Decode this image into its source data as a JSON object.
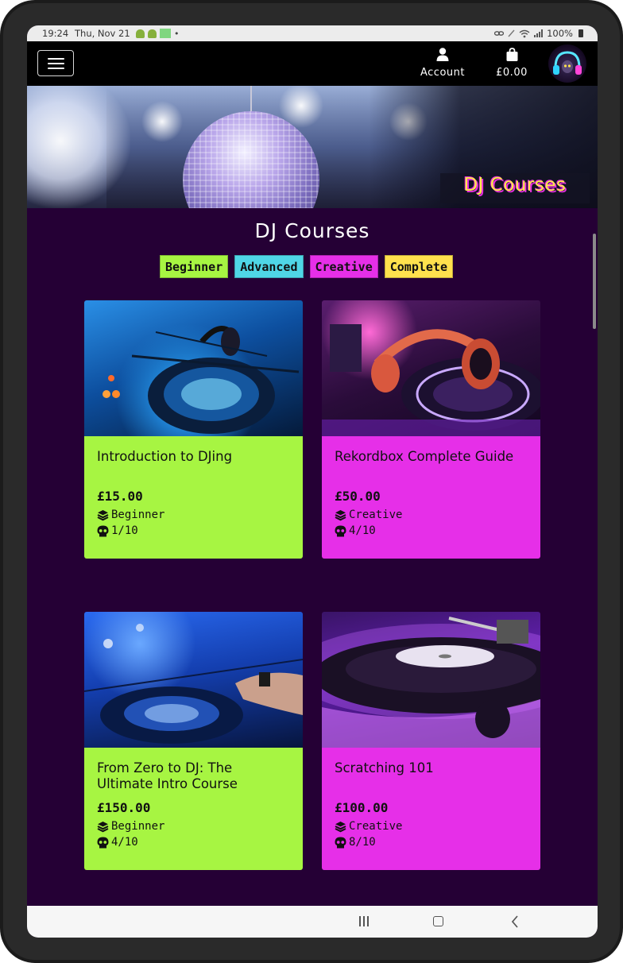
{
  "status_bar": {
    "time": "19:24",
    "date": "Thu, Nov 21",
    "dot": "•",
    "battery": "100%"
  },
  "navbar": {
    "account_label": "Account",
    "cart_total": "£0.00"
  },
  "hero": {
    "tag": "DJ Courses"
  },
  "page": {
    "title": "DJ Courses",
    "filters": [
      {
        "label": "Beginner",
        "color": "#a7f542"
      },
      {
        "label": "Advanced",
        "color": "#4fd6e6"
      },
      {
        "label": "Creative",
        "color": "#e62fe8"
      },
      {
        "label": "Complete",
        "color": "#ffe14d"
      }
    ]
  },
  "courses": [
    {
      "title": "Introduction to DJing",
      "price": "£15.00",
      "level": "Beginner",
      "difficulty": "1/10",
      "color": "#a7f542"
    },
    {
      "title": "Rekordbox Complete Guide",
      "price": "£50.00",
      "level": "Creative",
      "difficulty": "4/10",
      "color": "#e62fe8"
    },
    {
      "title": "From Zero to DJ: The Ultimate Intro Course",
      "price": "£150.00",
      "level": "Beginner",
      "difficulty": "4/10",
      "color": "#a7f542"
    },
    {
      "title": "Scratching 101",
      "price": "£100.00",
      "level": "Creative",
      "difficulty": "8/10",
      "color": "#e62fe8"
    }
  ]
}
